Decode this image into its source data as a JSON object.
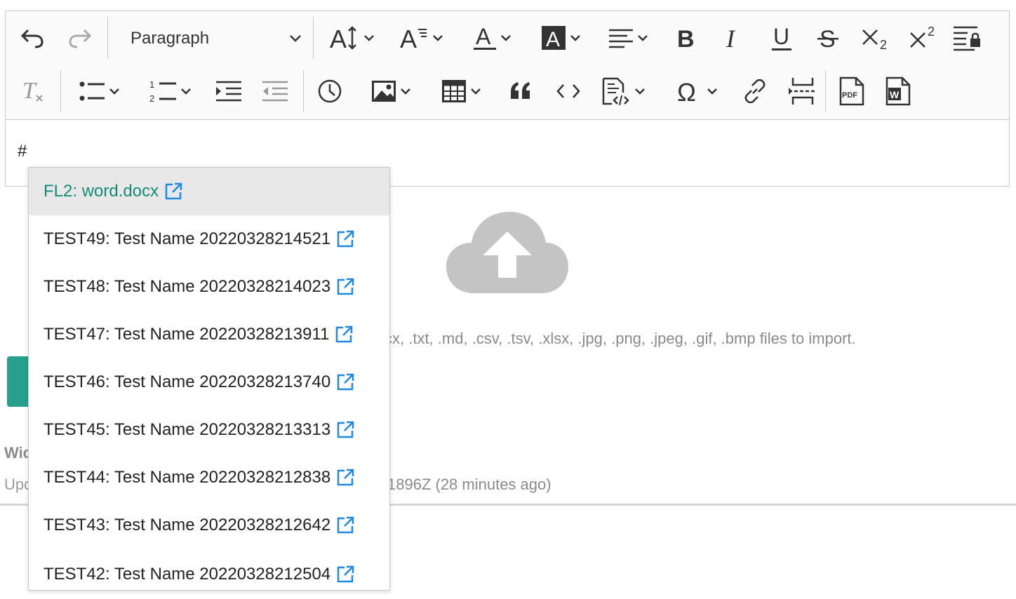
{
  "toolbar": {
    "paragraph_label": "Paragraph",
    "icons": [
      "undo-icon",
      "redo-icon",
      "font-size-icon",
      "font-family-icon",
      "font-color-icon",
      "font-background-color-icon",
      "align-left-icon",
      "bold-icon",
      "italic-icon",
      "underline-icon",
      "strikethrough-icon",
      "subscript-icon",
      "superscript-icon",
      "restricted-editing-icon",
      "remove-format-icon",
      "bulleted-list-icon",
      "numbered-list-icon",
      "indent-icon",
      "outdent-icon",
      "clock-icon",
      "image-icon",
      "table-icon",
      "block-quote-icon",
      "code-icon",
      "source-editing-icon",
      "special-characters-icon",
      "link-icon",
      "page-break-icon",
      "export-pdf-icon",
      "export-word-icon"
    ]
  },
  "editor": {
    "content": "#"
  },
  "mention": {
    "items": [
      {
        "label": "FL2: word.docx"
      },
      {
        "label": "TEST49: Test Name 20220328214521"
      },
      {
        "label": "TEST48: Test Name 20220328214023"
      },
      {
        "label": "TEST47: Test Name 20220328213911"
      },
      {
        "label": "TEST46: Test Name 20220328213740"
      },
      {
        "label": "TEST45: Test Name 20220328213313"
      },
      {
        "label": "TEST44: Test Name 20220328212838"
      },
      {
        "label": "TEST43: Test Name 20220328212642"
      },
      {
        "label": "TEST42: Test Name 20220328212504"
      }
    ]
  },
  "page": {
    "import_hint_tail": "cx, .txt, .md, .csv, .tsv, .xlsx, .jpg, .png, .jpeg, .gif, .bmp files to import.",
    "widget_label_partial": "Wid",
    "updated_prefix_partial": "Upd",
    "updated_tail": "1896Z (28 minutes ago)"
  },
  "colors": {
    "accent": "#26a08c",
    "link_icon": "#1e88e5",
    "active_text": "#158a78"
  }
}
